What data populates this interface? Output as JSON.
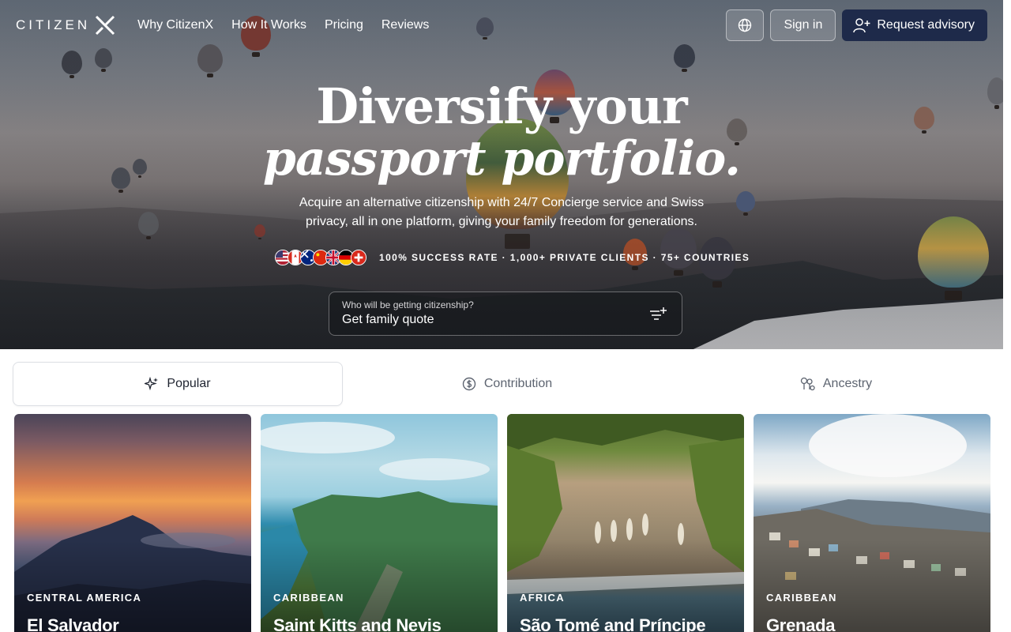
{
  "nav": {
    "logo_text": "CITIZEN",
    "links": [
      "Why CitizenX",
      "How It Works",
      "Pricing",
      "Reviews"
    ],
    "sign_in": "Sign in",
    "request_advisory": "Request advisory"
  },
  "hero": {
    "headline_line1": "Diversify your",
    "headline_line2": "passport portfolio.",
    "subline": "Acquire an alternative citizenship with 24/7 Concierge service and Swiss privacy, all in one platform, giving your family freedom for generations.",
    "stats": "100% SUCCESS RATE · 1,000+ PRIVATE CLIENTS · 75+ COUNTRIES",
    "flags": [
      "us-flag",
      "canada-flag",
      "australia-flag",
      "china-flag",
      "uk-flag",
      "germany-flag",
      "switzerland-flag"
    ]
  },
  "quote": {
    "label": "Who will be getting citizenship?",
    "value": "Get family quote"
  },
  "tabs": [
    {
      "label": "Popular",
      "icon": "sparkles-icon",
      "active": true
    },
    {
      "label": "Contribution",
      "icon": "dollar-circle-icon",
      "active": false
    },
    {
      "label": "Ancestry",
      "icon": "family-tree-icon",
      "active": false
    }
  ],
  "cards": [
    {
      "region": "CENTRAL AMERICA",
      "name": "El Salvador"
    },
    {
      "region": "CARIBBEAN",
      "name": "Saint Kitts and Nevis"
    },
    {
      "region": "AFRICA",
      "name": "São Tomé and Príncipe"
    },
    {
      "region": "CARIBBEAN",
      "name": "Grenada"
    }
  ],
  "colors": {
    "primary_navy": "#1e2a4a",
    "tab_text": "#5d6470",
    "tab_active_text": "#1f2430"
  }
}
